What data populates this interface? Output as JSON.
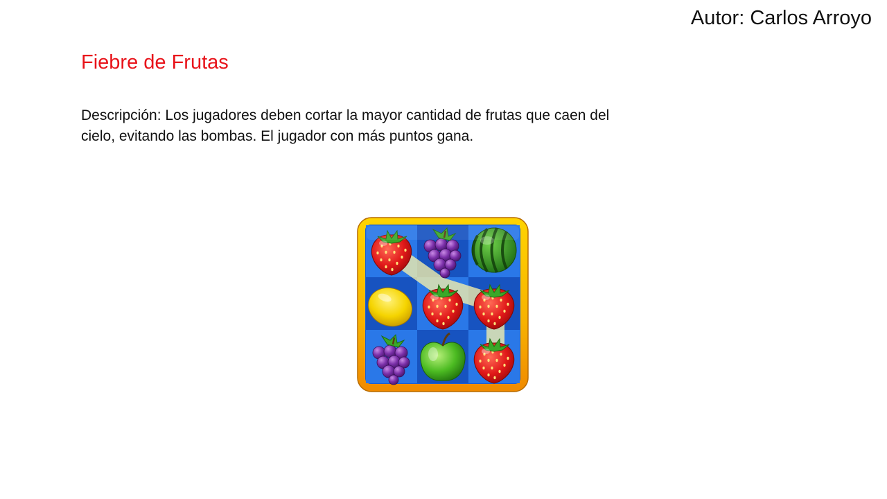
{
  "slide": {
    "author": "Autor: Carlos Arroyo",
    "title": "Fiebre de Frutas",
    "description": "Descripción: Los jugadores deben cortar la mayor cantidad de frutas que caen del cielo, evitando las bombas. El jugador con más puntos gana."
  },
  "colors": {
    "title": "#e8141b",
    "text": "#111111",
    "frame_gold": "#f5a800",
    "board_blue": "#1a5fd0"
  },
  "game_icon": {
    "grid": [
      [
        "strawberry",
        "grapes",
        "watermelon"
      ],
      [
        "lemon",
        "strawberry",
        "strawberry"
      ],
      [
        "grapes",
        "apple",
        "strawberry"
      ]
    ]
  }
}
